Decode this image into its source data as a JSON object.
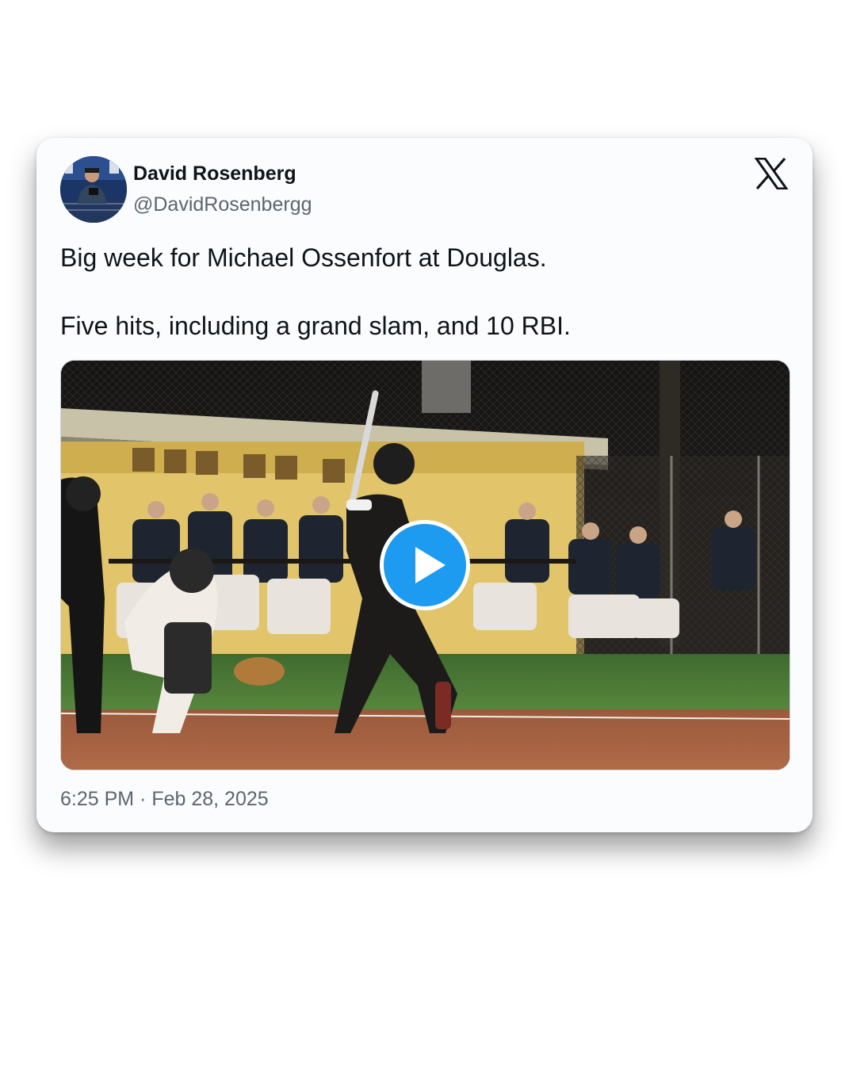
{
  "author": {
    "name": "David Rosenberg",
    "handle": "@DavidRosenbergg"
  },
  "platform_icon": "x-logo-icon",
  "tweet": {
    "paragraphs": [
      "Big week for Michael Ossenfort at Douglas.",
      "Five hits, including a grand slam, and 10 RBI."
    ]
  },
  "media": {
    "type": "video",
    "play_icon": "play-icon",
    "play_color": "#1d9bf0"
  },
  "timestamp": "6:25 PM · Feb 28, 2025"
}
